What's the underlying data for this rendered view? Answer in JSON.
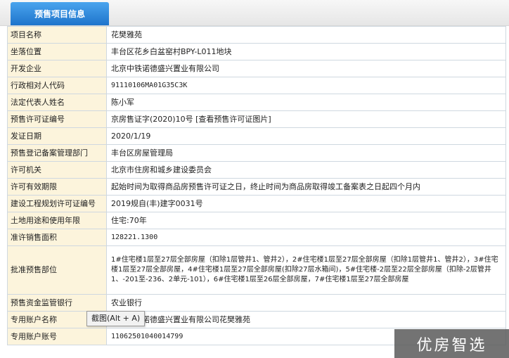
{
  "header": {
    "tab_label": "预售项目信息"
  },
  "rows": [
    {
      "label": "项目名称",
      "value": "花樊雅苑"
    },
    {
      "label": "坐落位置",
      "value": "丰台区花乡白盆窑村BPY-L011地块"
    },
    {
      "label": "开发企业",
      "value": "北京中铁诺德盛兴置业有限公司"
    },
    {
      "label": "行政相对人代码",
      "value": "91110106MA01G35C3K"
    },
    {
      "label": "法定代表人姓名",
      "value": "陈小军"
    },
    {
      "label": "预售许可证编号",
      "value": "京房售证字(2020)10号 [查看预售许可证图片]"
    },
    {
      "label": "发证日期",
      "value": "2020/1/19"
    },
    {
      "label": "预售登记备案管理部门",
      "value": "丰台区房屋管理局"
    },
    {
      "label": "许可机关",
      "value": "北京市住房和城乡建设委员会"
    },
    {
      "label": "许可有效期限",
      "value": "起始时间为取得商品房预售许可证之日，终止时间为商品房取得竣工备案表之日起四个月内"
    },
    {
      "label": "建设工程规划许可证编号",
      "value": "2019规自(丰)建字0031号"
    },
    {
      "label": "土地用途和使用年限",
      "value": "住宅:70年"
    },
    {
      "label": "准许销售面积",
      "value": "128221.1300"
    },
    {
      "label": "批准预售部位",
      "value": "1#住宅楼1层至27层全部房屋（扣除1层管井1、管井2），2#住宅楼1层至27层全部房屋（扣除1层管井1、管井2），3#住宅楼1层至27层全部房屋，4#住宅楼1层至27层全部房屋(扣除27层水箱间)，5#住宅楼-2层至22层全部房屋（扣除-2层管井1、-201至-236、2单元-101），6#住宅楼1层至26层全部房屋，7#住宅楼1层至27层全部房屋"
    },
    {
      "label": "预售资金监管银行",
      "value": "农业银行"
    },
    {
      "label": "专用账户名称",
      "value": "北京中铁诺德盛兴置业有限公司花樊雅苑"
    },
    {
      "label": "专用账户账号",
      "value": "11062501040014799"
    }
  ],
  "tooltip": "截图(Alt + A)",
  "watermark": "优房智选"
}
